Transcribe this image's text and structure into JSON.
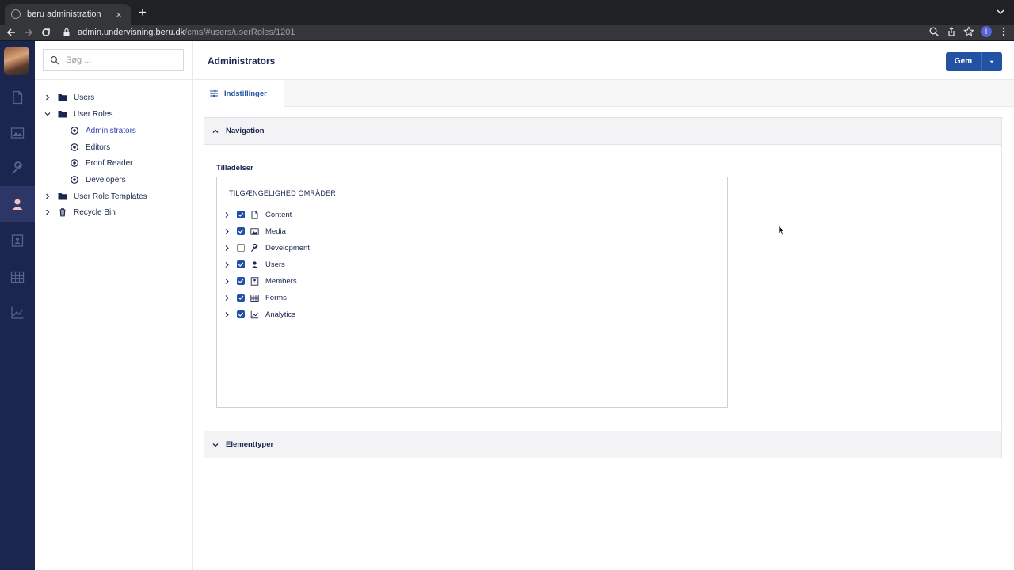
{
  "browser": {
    "tab_title": "beru administration",
    "new_tab_symbol": "+",
    "close_symbol": "×",
    "url_host": "admin.undervisning.beru.dk",
    "url_path": "/cms/#users/userRoles/1201",
    "profile_initial": "I"
  },
  "search": {
    "placeholder": "Søg ..."
  },
  "tree": {
    "users": "Users",
    "user_roles": "User Roles",
    "roles": [
      "Administrators",
      "Editors",
      "Proof Reader",
      "Developers"
    ],
    "templates": "User Role Templates",
    "recycle_bin": "Recycle Bin"
  },
  "header": {
    "title": "Administrators",
    "save_label": "Gem"
  },
  "subtab": {
    "label": "Indstillinger"
  },
  "navigation_panel": {
    "title": "Navigation",
    "permissions_label": "Tilladelser",
    "box_title": "TILGÆNGELIGHED OMRÅDER",
    "sections": [
      {
        "label": "Content",
        "icon": "document-icon",
        "checked": true
      },
      {
        "label": "Media",
        "icon": "image-icon",
        "checked": true
      },
      {
        "label": "Development",
        "icon": "wrench-icon",
        "checked": false
      },
      {
        "label": "Users",
        "icon": "user-icon",
        "checked": true
      },
      {
        "label": "Members",
        "icon": "member-card-icon",
        "checked": true
      },
      {
        "label": "Forms",
        "icon": "table-icon",
        "checked": true
      },
      {
        "label": "Analytics",
        "icon": "chart-icon",
        "checked": true
      }
    ]
  },
  "element_panel": {
    "title": "Elementtyper"
  },
  "colors": {
    "rail": "#1b264f",
    "accent": "#2152a3",
    "selected": "#3544b1"
  }
}
